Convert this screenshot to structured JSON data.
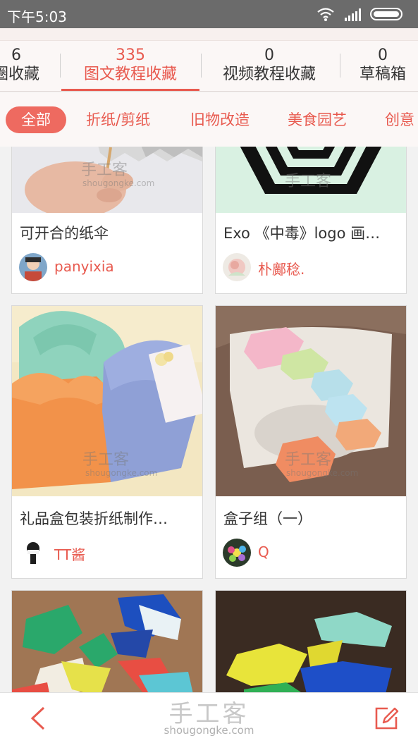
{
  "status_bar": {
    "time": "下午5:03"
  },
  "tabs": [
    {
      "count": "6",
      "label": "圈收藏"
    },
    {
      "count": "335",
      "label": "图文教程收藏"
    },
    {
      "count": "0",
      "label": "视频教程收藏"
    },
    {
      "count": "0",
      "label": "草稿箱"
    }
  ],
  "categories": [
    "全部",
    "折纸/剪纸",
    "旧物改造",
    "美食园艺",
    "创意"
  ],
  "cards": [
    {
      "title": "可开合的纸伞",
      "author": "panyixia"
    },
    {
      "title": "Exo 《中毒》logo 画…",
      "author": "朴鄺稔."
    },
    {
      "title": "礼品盒包装折纸制作…",
      "author": "TT酱"
    },
    {
      "title": "盒子组（一）",
      "author": "Q"
    }
  ],
  "watermark": {
    "cn": "手工客",
    "en": "shougongke.com"
  },
  "bottom_bar": {
    "brand_cn": "手工客",
    "brand_en": "shougongke.com"
  },
  "colors": {
    "accent": "#e85a4f",
    "status_bar": "#6b6b6b"
  }
}
